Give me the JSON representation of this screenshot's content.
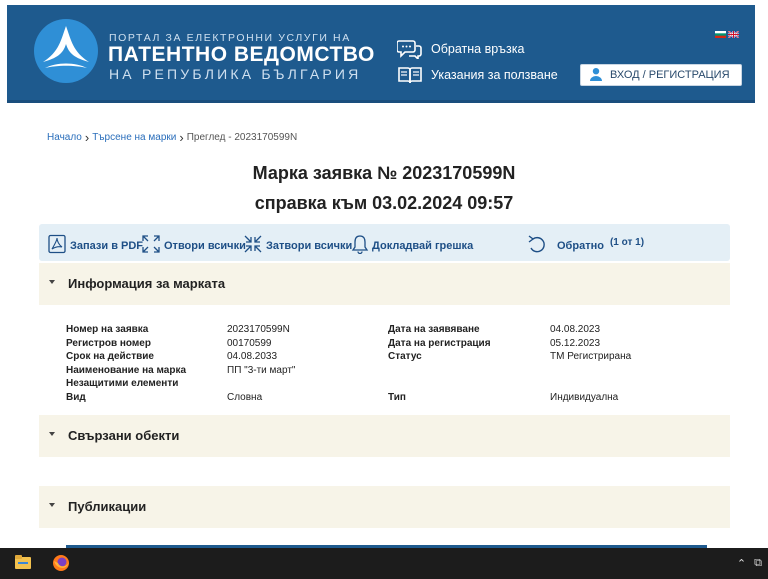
{
  "header": {
    "brand_line1": "ПОРТАЛ ЗА ЕЛЕКТРОННИ УСЛУГИ НА",
    "brand_line2": "ПАТЕНТНО ВЕДОМСТВО",
    "brand_line3": "НА РЕПУБЛИКА БЪЛГАРИЯ",
    "feedback_label": "Обратна връзка",
    "instructions_label": "Указания за ползване",
    "login_label": "ВХОД / РЕГИСТРАЦИЯ"
  },
  "breadcrumb": {
    "home": "Начало",
    "search": "Търсене на марки",
    "current": "Преглед - 2023170599N"
  },
  "title": {
    "line1": "Марка заявка № 2023170599N",
    "line2": "справка към 03.02.2024 09:57"
  },
  "toolbar": {
    "save_pdf": "Запази в PDF",
    "expand_all": "Отвори всички",
    "collapse_all": "Затвори всички",
    "report_error": "Докладвай грешка",
    "back": "Обратно",
    "page_count": "(1 от 1)"
  },
  "sections": {
    "info_title": "Информация за марката",
    "related_title": "Свързани обекти",
    "publications_title": "Публикации"
  },
  "info": {
    "left_labels": [
      "Номер на заявка",
      "Регистров номер",
      "Срок на действие",
      "Наименование на марка",
      "Незащитими елементи",
      "Вид"
    ],
    "left_values": [
      "2023170599N",
      "00170599",
      "04.08.2033",
      "ПП \"3-ти март\"",
      "",
      "Словна"
    ],
    "right_labels": [
      "Дата на заявяване",
      "Дата на регистрация",
      "Статус",
      "",
      "",
      "Тип"
    ],
    "right_values": [
      "04.08.2023",
      "05.12.2023",
      "ТМ Регистрирана",
      "",
      "",
      "Индивидуална"
    ]
  },
  "colors": {
    "header_bg": "#1e5a8e",
    "link": "#2a6ebb",
    "toolbar_bg": "#e4eff6",
    "section_bg": "#f7f4e8"
  }
}
